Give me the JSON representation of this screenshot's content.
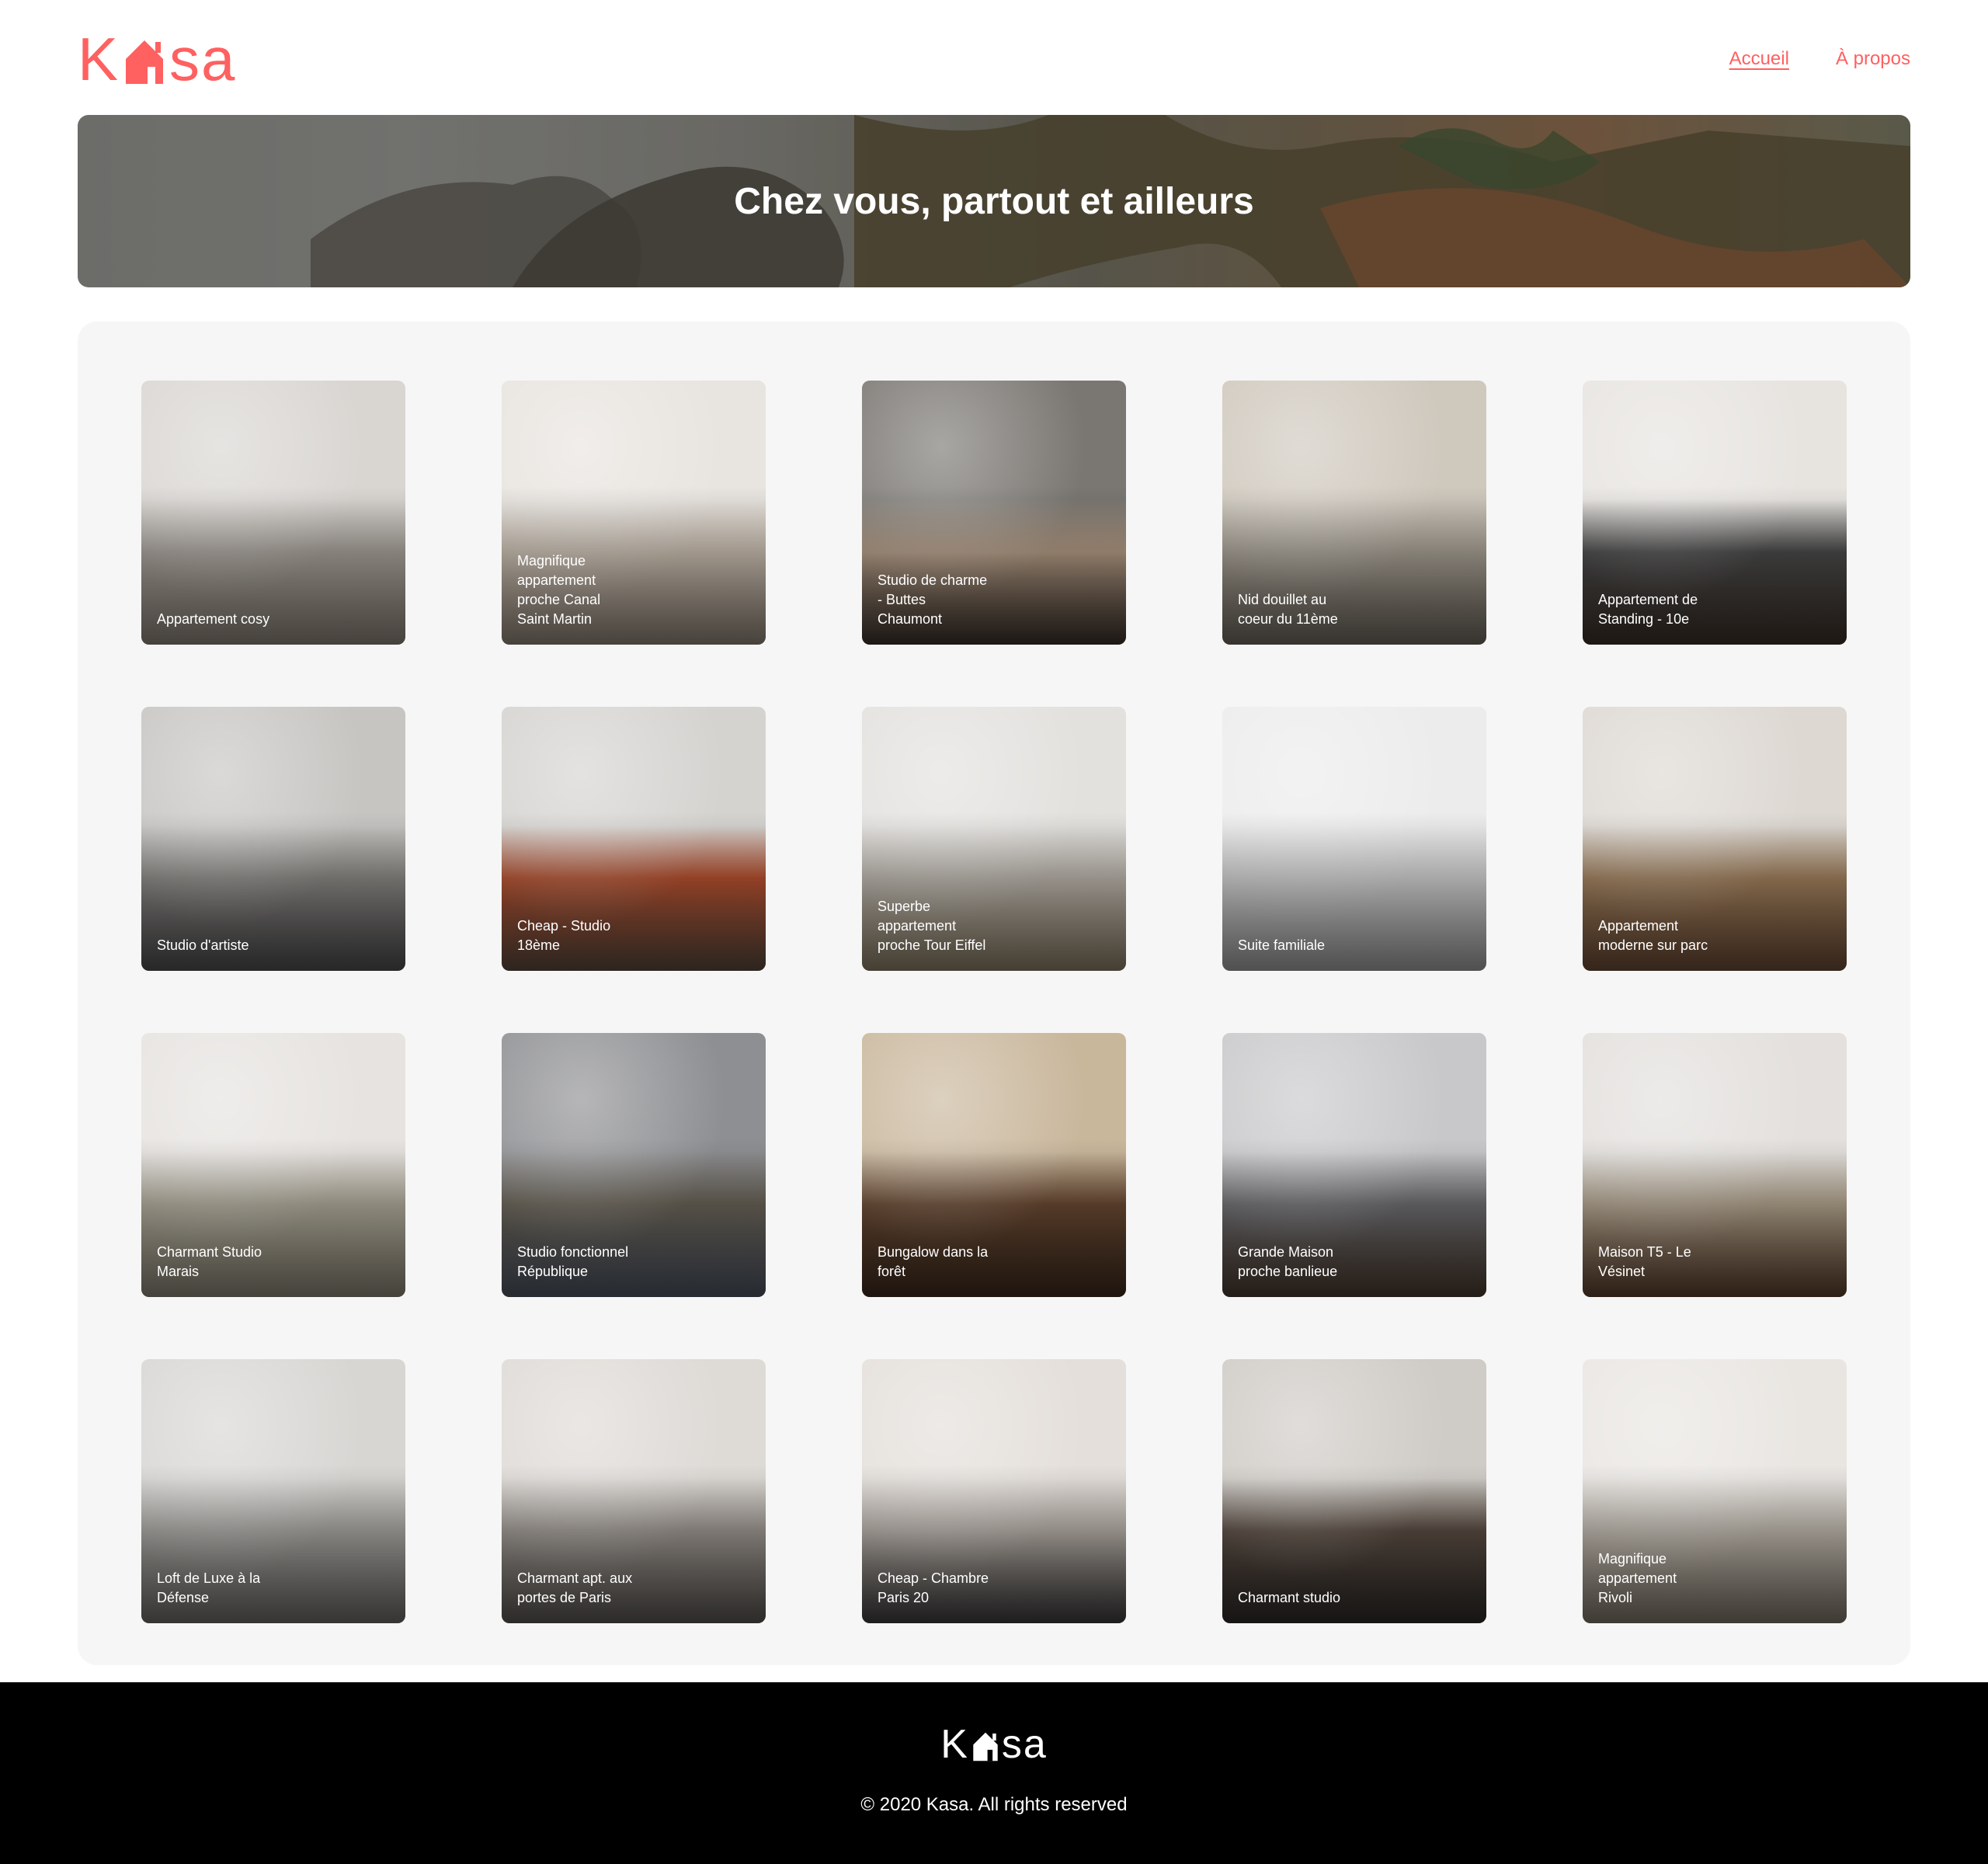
{
  "brand": {
    "logo_left": "K",
    "logo_right": "sa",
    "color": "#FF6060"
  },
  "nav": {
    "items": [
      {
        "label": "Accueil",
        "active": true
      },
      {
        "label": "À propos",
        "active": false
      }
    ]
  },
  "banner": {
    "title": "Chez vous, partout et ailleurs"
  },
  "listings": [
    {
      "title": "Appartement cosy",
      "tone": [
        "#d9d6d2",
        "#a9a39b",
        "#8b8378"
      ]
    },
    {
      "title": "Magnifique appartement proche Canal Saint Martin",
      "tone": [
        "#e8e4df",
        "#cbbfb1",
        "#8f8478"
      ]
    },
    {
      "title": "Studio de charme - Buttes Chaumont",
      "tone": [
        "#7a7772",
        "#b59d86",
        "#3a302a"
      ]
    },
    {
      "title": "Nid douillet au coeur du 11ème",
      "tone": [
        "#cfc8bd",
        "#a9a296",
        "#6d665c"
      ]
    },
    {
      "title": "Appartement de Standing - 10e",
      "tone": [
        "#e7e4e0",
        "#4a4a4a",
        "#3b3028"
      ]
    },
    {
      "title": "Studio d'artiste",
      "tone": [
        "#c7c5c2",
        "#8c8a86",
        "#4f4e50"
      ]
    },
    {
      "title": "Cheap - Studio 18ème",
      "tone": [
        "#d5d3d0",
        "#b8512f",
        "#5b4a3e"
      ]
    },
    {
      "title": "Superbe appartement proche Tour Eiffel",
      "tone": [
        "#e3e1de",
        "#bdb7ae",
        "#8a7d66"
      ]
    },
    {
      "title": "Suite familiale",
      "tone": [
        "#ececec",
        "#d3d3d3",
        "#9f9f9f"
      ]
    },
    {
      "title": "Appartement moderne sur parc",
      "tone": [
        "#ddd8d2",
        "#a4825e",
        "#6a4a35"
      ]
    },
    {
      "title": "Charmant Studio Marais",
      "tone": [
        "#e6e3e0",
        "#b2ad9c",
        "#8a8576"
      ]
    },
    {
      "title": "Studio fonctionnel République",
      "tone": [
        "#8e8f92",
        "#6b6458",
        "#4d5563"
      ]
    },
    {
      "title": "Bungalow dans la forêt",
      "tone": [
        "#c9b79c",
        "#6b4a33",
        "#3e2b1e"
      ]
    },
    {
      "title": "Grande Maison proche banlieue",
      "tone": [
        "#c8c8ca",
        "#6f6f73",
        "#4a3b2f"
      ]
    },
    {
      "title": "Maison T5 - Le Vésinet",
      "tone": [
        "#e3e0dd",
        "#b5a690",
        "#5a3f2c"
      ]
    },
    {
      "title": "Loft de Luxe à la Défense",
      "tone": [
        "#d8d6d3",
        "#a9a7a3",
        "#6d6a66"
      ]
    },
    {
      "title": "Charmant apt. aux portes de Paris",
      "tone": [
        "#dedad6",
        "#9e9892",
        "#5a5652"
      ]
    },
    {
      "title": "Cheap - Chambre Paris 20",
      "tone": [
        "#e4dfda",
        "#b7b0a8",
        "#3d3b3b"
      ]
    },
    {
      "title": "Charmant studio",
      "tone": [
        "#cfcbc6",
        "#5b4d43",
        "#2e2a28"
      ]
    },
    {
      "title": "Magnifique appartement Rivoli",
      "tone": [
        "#e9e6e2",
        "#bfb8ad",
        "#7d7468"
      ]
    }
  ],
  "footer": {
    "copyright": "© 2020 Kasa. All rights reserved"
  }
}
